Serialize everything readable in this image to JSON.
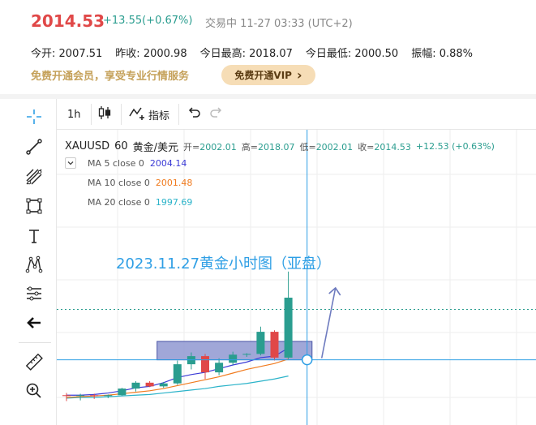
{
  "quote": {
    "price": "2014.53",
    "change": "+13.55(+0.67%)",
    "status": "交易中 11-27 03:33 (UTC+2)",
    "stats": [
      {
        "label": "今开:",
        "value": "2007.51"
      },
      {
        "label": "昨收:",
        "value": "2000.98"
      },
      {
        "label": "今日最高:",
        "value": "2018.07"
      },
      {
        "label": "今日最低:",
        "value": "2000.50"
      },
      {
        "label": "振幅:",
        "value": "0.88%"
      }
    ],
    "promo_text": "免费开通会员，享受专业行情服务",
    "vip_button": "免费开通VIP",
    "vip_arrow": "›"
  },
  "toolbar": {
    "interval": "1h",
    "indicators": "指标",
    "left_tools": [
      "crosshair-icon",
      "trend-line-icon",
      "fib-icon",
      "rectangle-icon",
      "text-icon",
      "pattern-icon",
      "long-position-icon",
      "back-arrow-icon",
      "ruler-icon",
      "zoom-in-icon"
    ]
  },
  "legend": {
    "symbol": "XAUUSD",
    "timeframe": "60",
    "name": "黄金/美元",
    "open_label": "开=",
    "open": "2002.01",
    "high_label": "高=",
    "high": "2018.07",
    "low_label": "低=",
    "low": "2002.01",
    "close_label": "收=",
    "close": "2014.53",
    "change": "+12.53 (+0.63%)",
    "ma": [
      {
        "label": "MA 5 close 0",
        "value": "2004.14",
        "color": "#3b3bd6"
      },
      {
        "label": "MA 10 close 0",
        "value": "2001.48",
        "color": "#f07b1f"
      },
      {
        "label": "MA 20 close 0",
        "value": "1997.69",
        "color": "#2bb3c9"
      }
    ]
  },
  "annotation": "2023.11.27黄金小时图（亚盘）",
  "colors": {
    "up": "#2a9d8f",
    "down": "#e04848",
    "accent": "#2f9fe5",
    "box": "#8f98d1"
  },
  "chart_data": {
    "type": "candlestick",
    "candles": [
      {
        "o": 2001.3,
        "h": 2001.6,
        "l": 2000.5,
        "c": 2001.2
      },
      {
        "o": 2001.2,
        "h": 2001.5,
        "l": 2000.6,
        "c": 2001.3
      },
      {
        "o": 2001.3,
        "h": 2001.5,
        "l": 2000.8,
        "c": 2001.2
      },
      {
        "o": 2001.2,
        "h": 2001.4,
        "l": 2000.9,
        "c": 2001.3
      },
      {
        "o": 2001.3,
        "h": 2002.3,
        "l": 2001.2,
        "c": 2002.2
      },
      {
        "o": 2002.2,
        "h": 2003.2,
        "l": 2001.8,
        "c": 2003.0
      },
      {
        "o": 2003.0,
        "h": 2003.2,
        "l": 2002.4,
        "c": 2002.5
      },
      {
        "o": 2002.5,
        "h": 2003.1,
        "l": 2002.3,
        "c": 2002.9
      },
      {
        "o": 2002.9,
        "h": 2006.0,
        "l": 2002.7,
        "c": 2005.5
      },
      {
        "o": 2005.5,
        "h": 2007.1,
        "l": 2004.8,
        "c": 2006.6
      },
      {
        "o": 2006.6,
        "h": 2006.9,
        "l": 2003.5,
        "c": 2004.4
      },
      {
        "o": 2004.4,
        "h": 2006.3,
        "l": 2004.0,
        "c": 2005.7
      },
      {
        "o": 2005.7,
        "h": 2007.2,
        "l": 2005.4,
        "c": 2006.8
      },
      {
        "o": 2006.8,
        "h": 2007.0,
        "l": 2006.5,
        "c": 2006.9
      },
      {
        "o": 2006.9,
        "h": 2010.6,
        "l": 2006.7,
        "c": 2009.9
      },
      {
        "o": 2009.9,
        "h": 2010.1,
        "l": 2006.0,
        "c": 2006.4
      },
      {
        "o": 2006.4,
        "h": 2018.07,
        "l": 2006.2,
        "c": 2014.53
      }
    ],
    "ma5": [
      2001.3,
      2001.3,
      2001.4,
      2001.6,
      2001.9,
      2002.3,
      2002.5,
      2003.0,
      2003.7,
      2004.1,
      2004.4,
      2004.9,
      2005.4,
      2005.8,
      2006.4,
      2006.6,
      2007.7
    ],
    "ma10": [
      2001.0,
      2001.1,
      2001.2,
      2001.3,
      2001.5,
      2001.7,
      2001.9,
      2002.2,
      2002.6,
      2003.0,
      2003.4,
      2003.8,
      2004.3,
      2004.8,
      2005.2,
      2005.6,
      2006.2
    ],
    "ma20": [
      2000.9,
      2001.0,
      2001.0,
      2001.1,
      2001.2,
      2001.3,
      2001.4,
      2001.6,
      2001.8,
      2002.0,
      2002.2,
      2002.5,
      2002.7,
      2002.9,
      2003.2,
      2003.5,
      2003.9
    ],
    "ylim": [
      1999.9,
      2023.0
    ],
    "reference_price": 2012.93,
    "crosshair_price": 2006.1,
    "range_box": {
      "from": 7,
      "to": 18,
      "low": 2006.1,
      "high": 2008.6
    }
  }
}
